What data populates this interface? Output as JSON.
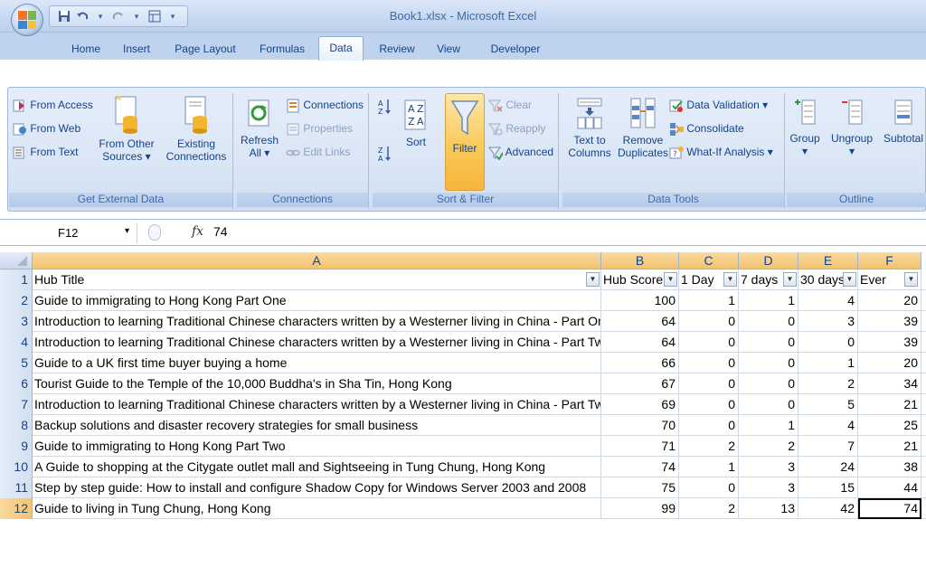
{
  "window": {
    "title": "Book1.xlsx - Microsoft Excel"
  },
  "qat": {
    "save": "save-icon",
    "undo": "undo-icon",
    "redo": "redo-icon",
    "customize": "▾"
  },
  "tabs": [
    {
      "label": "Home"
    },
    {
      "label": "Insert"
    },
    {
      "label": "Page Layout"
    },
    {
      "label": "Formulas"
    },
    {
      "label": "Data"
    },
    {
      "label": "Review"
    },
    {
      "label": "View"
    },
    {
      "label": "Developer"
    }
  ],
  "ribbon": {
    "external": {
      "label": "Get External Data",
      "from_access": "From Access",
      "from_web": "From Web",
      "from_text": "From Text",
      "from_other_1": "From Other",
      "from_other_2": "Sources ▾",
      "existing_1": "Existing",
      "existing_2": "Connections"
    },
    "connections": {
      "label": "Connections",
      "refresh_1": "Refresh",
      "refresh_2": "All ▾",
      "connections": "Connections",
      "properties": "Properties",
      "edit_links": "Edit Links"
    },
    "sort_filter": {
      "label": "Sort & Filter",
      "sort": "Sort",
      "filter": "Filter",
      "clear": "Clear",
      "reapply": "Reapply",
      "advanced": "Advanced",
      "az": "A Z",
      "sort_az": "A↓Z",
      "sort_za": "Z↓A"
    },
    "data_tools": {
      "label": "Data Tools",
      "text_to_1": "Text to",
      "text_to_2": "Columns",
      "remove_1": "Remove",
      "remove_2": "Duplicates",
      "validation": "Data Validation ▾",
      "consolidate": "Consolidate",
      "whatif": "What-If Analysis ▾"
    },
    "outline": {
      "label": "Outline",
      "group": "Group",
      "ungroup": "Ungroup",
      "subtotal": "Subtotal",
      "dropdown": "▾"
    }
  },
  "formula_bar": {
    "name": "F12",
    "name_arrow": "▾",
    "fx": "fx",
    "value": "74"
  },
  "columns": [
    "A",
    "B",
    "C",
    "D",
    "E",
    "F"
  ],
  "header_row": {
    "num": "1",
    "a": "Hub Title",
    "b": "Hub Score",
    "c": "1 Day",
    "d": "7 days",
    "e": "30 days",
    "f": "Ever",
    "filter_btn": "▼"
  },
  "rows": [
    {
      "num": "2",
      "title": "Guide to immigrating to Hong Kong Part One",
      "score": "100",
      "d1": "1",
      "d7": "1",
      "d30": "4",
      "ever": "20"
    },
    {
      "num": "3",
      "title": "Introduction to learning Traditional Chinese characters written by a Westerner living in China - Part One",
      "score": "64",
      "d1": "0",
      "d7": "0",
      "d30": "3",
      "ever": "39"
    },
    {
      "num": "4",
      "title": "Introduction to learning Traditional Chinese characters written by a Westerner living in China - Part Two",
      "score": "64",
      "d1": "0",
      "d7": "0",
      "d30": "0",
      "ever": "39"
    },
    {
      "num": "5",
      "title": "Guide to a UK first time buyer buying a home",
      "score": "66",
      "d1": "0",
      "d7": "0",
      "d30": "1",
      "ever": "20"
    },
    {
      "num": "6",
      "title": "Tourist Guide to the Temple of the 10,000 Buddha's in Sha Tin, Hong Kong",
      "score": "67",
      "d1": "0",
      "d7": "0",
      "d30": "2",
      "ever": "34"
    },
    {
      "num": "7",
      "title": "Introduction to learning Traditional Chinese characters written by a Westerner living in China - Part Two",
      "score": "69",
      "d1": "0",
      "d7": "0",
      "d30": "5",
      "ever": "21"
    },
    {
      "num": "8",
      "title": "Backup solutions and disaster recovery strategies for small business",
      "score": "70",
      "d1": "0",
      "d7": "1",
      "d30": "4",
      "ever": "25"
    },
    {
      "num": "9",
      "title": "Guide to immigrating to Hong Kong Part Two",
      "score": "71",
      "d1": "2",
      "d7": "2",
      "d30": "7",
      "ever": "21"
    },
    {
      "num": "10",
      "title": "A Guide to shopping at the Citygate outlet mall and Sightseeing in Tung Chung, Hong Kong",
      "score": "74",
      "d1": "1",
      "d7": "3",
      "d30": "24",
      "ever": "38"
    },
    {
      "num": "11",
      "title": "Step by step guide: How to install and configure Shadow Copy for Windows Server 2003 and 2008",
      "score": "75",
      "d1": "0",
      "d7": "3",
      "d30": "15",
      "ever": "44"
    },
    {
      "num": "12",
      "title": "Guide to living in Tung Chung, Hong Kong",
      "score": "99",
      "d1": "2",
      "d7": "13",
      "d30": "42",
      "ever": "74"
    }
  ]
}
